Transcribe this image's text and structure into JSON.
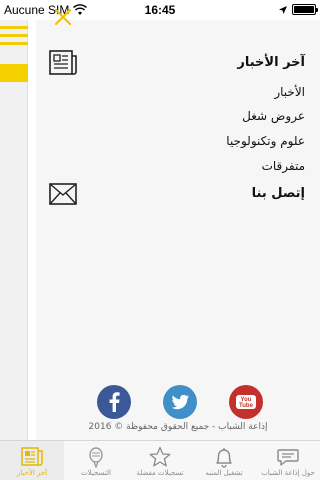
{
  "status_bar": {
    "carrier": "Aucune SIM",
    "time": "16:45",
    "battery_percent": 100
  },
  "menu": {
    "section_news": "آخر الأخبار",
    "items": [
      "الأخبار",
      "عروض شغل",
      "علوم وتكنولوجيا",
      "متفرقات"
    ],
    "contact_us": "إتصل بنا"
  },
  "social": {
    "youtube_label": "You Tube",
    "copyright": "إذاعة الشباب - جميع الحقوق محفوظة © 2016"
  },
  "tabs": [
    {
      "label": "آخر الأخبار",
      "icon": "news-tab-icon",
      "active": true
    },
    {
      "label": "التسجيلات",
      "icon": "microphone-icon",
      "active": false
    },
    {
      "label": "تسجيلات مفضلة",
      "icon": "star-icon",
      "active": false
    },
    {
      "label": "تشغيل المنبه",
      "icon": "bell-icon",
      "active": false
    },
    {
      "label": "حول إذاعة الشباب",
      "icon": "chat-bubble-icon",
      "active": false
    }
  ],
  "colors": {
    "accent_yellow": "#f5d000",
    "facebook": "#3b5998",
    "twitter": "#3f8fc9",
    "youtube": "#c4302b"
  }
}
